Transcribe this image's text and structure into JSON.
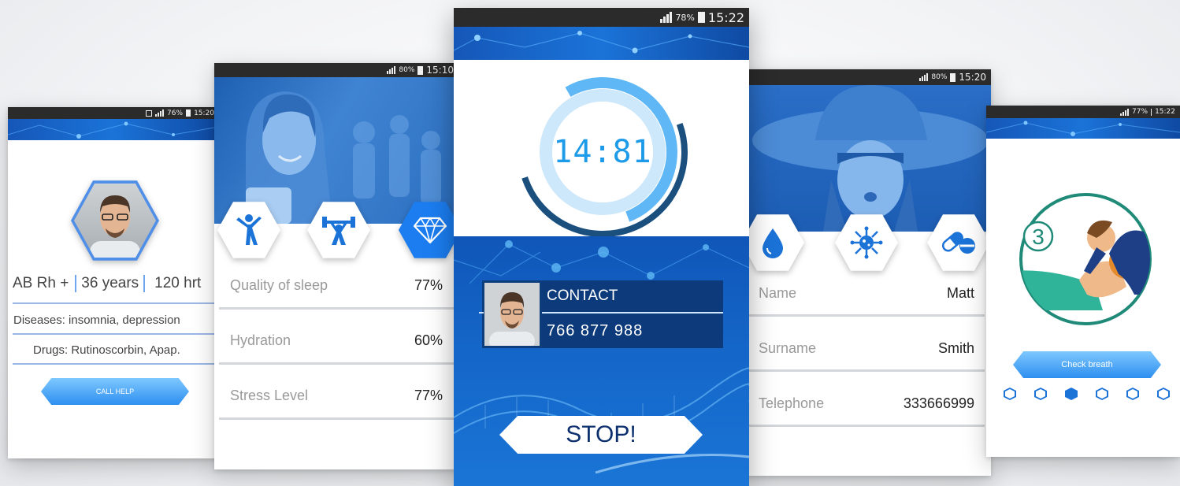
{
  "phones": {
    "profile": {
      "status": {
        "battery": "76%",
        "time": "15:20"
      },
      "blood": "AB Rh +",
      "age": "36 years",
      "hr": "120 hrt",
      "diseases": "Diseases: insomnia, depression",
      "drugs": "Drugs: Rutinoscorbin, Apap.",
      "button": "CALL HELP"
    },
    "stats": {
      "status": {
        "battery": "80%",
        "time": "15:10"
      },
      "rows": [
        {
          "label": "Quality of sleep",
          "value": "77%"
        },
        {
          "label": "Hydration",
          "value": "60%"
        },
        {
          "label": "Stress Level",
          "value": "77%"
        }
      ]
    },
    "timer": {
      "status": {
        "battery": "78%",
        "time": "15:22"
      },
      "clock": "14:81",
      "contact_label": "CONTACT",
      "contact_number": "766 877 988",
      "stop": "STOP!"
    },
    "info": {
      "status": {
        "battery": "80%",
        "time": "15:20"
      },
      "rows": [
        {
          "label": "Name",
          "value": "Matt"
        },
        {
          "label": "Surname",
          "value": "Smith"
        },
        {
          "label": "Telephone",
          "value": "333666999"
        }
      ]
    },
    "cpr": {
      "status": {
        "battery": "77%",
        "time": "15:22"
      },
      "step": "3",
      "button": "Check breath",
      "active_dot": 2
    }
  },
  "colors": {
    "accent": "#1b73d8",
    "light_blue": "#5fb8f5",
    "dark_navy": "#0c3a7a",
    "teal": "#1f8a78"
  }
}
